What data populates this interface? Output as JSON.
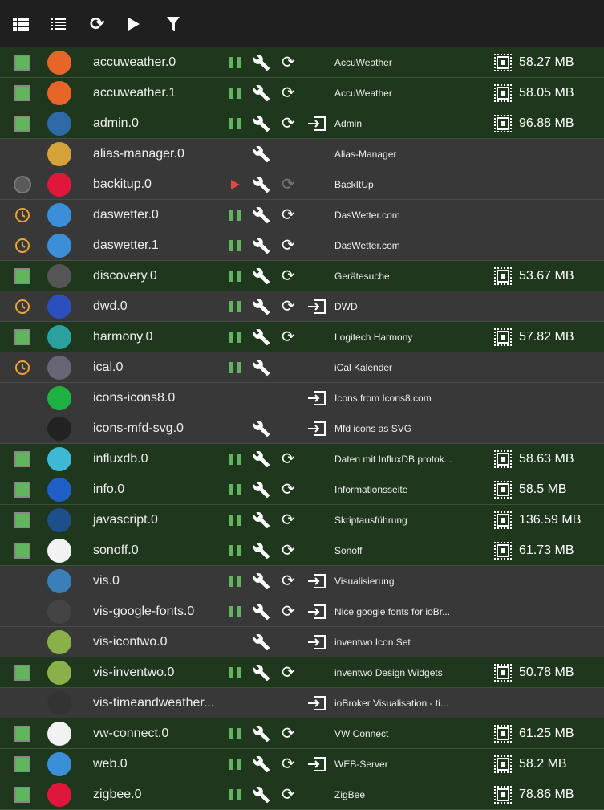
{
  "toolbar": {
    "icons": [
      "view-table-icon",
      "view-list-icon",
      "refresh-icon",
      "play-icon",
      "filter-icon"
    ]
  },
  "colors": {
    "running": "#1e371d",
    "stopped": "#383838",
    "status_green": "#5fb65c",
    "clock": "#e8a33c",
    "play": "#e04848"
  },
  "instances": [
    {
      "name": "accuweather.0",
      "status": "green",
      "pause": true,
      "wrench": true,
      "restart": true,
      "link": false,
      "title": "AccuWeather",
      "mem": "58.27 MB",
      "icon": "#e8652a"
    },
    {
      "name": "accuweather.1",
      "status": "green",
      "pause": true,
      "wrench": true,
      "restart": true,
      "link": false,
      "title": "AccuWeather",
      "mem": "58.05 MB",
      "icon": "#e8652a"
    },
    {
      "name": "admin.0",
      "status": "green",
      "pause": true,
      "wrench": true,
      "restart": true,
      "link": true,
      "title": "Admin",
      "mem": "96.88 MB",
      "icon": "#2f6aa8"
    },
    {
      "name": "alias-manager.0",
      "status": "none",
      "pause": false,
      "wrench": true,
      "restart": false,
      "link": false,
      "title": "Alias-Manager",
      "mem": "",
      "icon": "#d6a23a"
    },
    {
      "name": "backitup.0",
      "status": "gray",
      "play": true,
      "wrench": true,
      "restart": "disabled",
      "link": false,
      "title": "BackItUp",
      "mem": "",
      "icon": "#e0173c"
    },
    {
      "name": "daswetter.0",
      "status": "clock",
      "pause": true,
      "wrench": true,
      "restart": true,
      "link": false,
      "title": "DasWetter.com",
      "mem": "",
      "icon": "#3a8fd8"
    },
    {
      "name": "daswetter.1",
      "status": "clock",
      "pause": true,
      "wrench": true,
      "restart": true,
      "link": false,
      "title": "DasWetter.com",
      "mem": "",
      "icon": "#3a8fd8"
    },
    {
      "name": "discovery.0",
      "status": "green",
      "pause": true,
      "wrench": true,
      "restart": true,
      "link": false,
      "title": "Gerätesuche",
      "mem": "53.67 MB",
      "icon": "#555"
    },
    {
      "name": "dwd.0",
      "status": "clock",
      "pause": true,
      "wrench": true,
      "restart": true,
      "link": true,
      "title": "DWD",
      "mem": "",
      "icon": "#2c4fc0"
    },
    {
      "name": "harmony.0",
      "status": "green",
      "pause": true,
      "wrench": true,
      "restart": true,
      "link": false,
      "title": "Logitech Harmony",
      "mem": "57.82 MB",
      "icon": "#2aa0a0"
    },
    {
      "name": "ical.0",
      "status": "clock",
      "pause": true,
      "wrench": true,
      "restart": false,
      "link": false,
      "title": "iCal Kalender",
      "mem": "",
      "icon": "#667"
    },
    {
      "name": "icons-icons8.0",
      "status": "none",
      "pause": false,
      "wrench": false,
      "restart": false,
      "link": true,
      "title": "Icons from Icons8.com",
      "mem": "",
      "icon": "#1fb141"
    },
    {
      "name": "icons-mfd-svg.0",
      "status": "none",
      "pause": false,
      "wrench": true,
      "restart": false,
      "link": true,
      "title": "Mfd icons as SVG",
      "mem": "",
      "icon": "#222"
    },
    {
      "name": "influxdb.0",
      "status": "green",
      "pause": true,
      "wrench": true,
      "restart": true,
      "link": false,
      "title": "Daten mit InfluxDB protok...",
      "mem": "58.63 MB",
      "icon": "#3fb8d6"
    },
    {
      "name": "info.0",
      "status": "green",
      "pause": true,
      "wrench": true,
      "restart": true,
      "link": false,
      "title": "Informationsseite",
      "mem": "58.5 MB",
      "icon": "#1f5fc8"
    },
    {
      "name": "javascript.0",
      "status": "green",
      "pause": true,
      "wrench": true,
      "restart": true,
      "link": false,
      "title": "Skriptausführung",
      "mem": "136.59 MB",
      "icon": "#1d4f8a"
    },
    {
      "name": "sonoff.0",
      "status": "green",
      "pause": true,
      "wrench": true,
      "restart": true,
      "link": false,
      "title": "Sonoff",
      "mem": "61.73 MB",
      "icon": "#f2f2f2"
    },
    {
      "name": "vis.0",
      "status": "none",
      "pause": true,
      "wrench": true,
      "restart": true,
      "link": true,
      "title": "Visualisierung",
      "mem": "",
      "icon": "#3a7fb8"
    },
    {
      "name": "vis-google-fonts.0",
      "status": "none",
      "pause": true,
      "wrench": true,
      "restart": true,
      "link": true,
      "title": "Nice google fonts for ioBr...",
      "mem": "",
      "icon": "#444"
    },
    {
      "name": "vis-icontwo.0",
      "status": "none",
      "pause": false,
      "wrench": true,
      "restart": false,
      "link": true,
      "title": "inventwo Icon Set",
      "mem": "",
      "icon": "#8ab04a"
    },
    {
      "name": "vis-inventwo.0",
      "status": "green",
      "pause": true,
      "wrench": true,
      "restart": true,
      "link": false,
      "title": "inventwo Design Widgets",
      "mem": "50.78 MB",
      "icon": "#8ab04a"
    },
    {
      "name": "vis-timeandweather...",
      "status": "none",
      "pause": false,
      "wrench": false,
      "restart": false,
      "link": true,
      "title": "ioBroker Visualisation - ti...",
      "mem": "",
      "icon": "#333"
    },
    {
      "name": "vw-connect.0",
      "status": "green",
      "pause": true,
      "wrench": true,
      "restart": true,
      "link": false,
      "title": "VW Connect",
      "mem": "61.25 MB",
      "icon": "#f2f2f2"
    },
    {
      "name": "web.0",
      "status": "green",
      "pause": true,
      "wrench": true,
      "restart": true,
      "link": true,
      "title": "WEB-Server",
      "mem": "58.2 MB",
      "icon": "#3a8fd8"
    },
    {
      "name": "zigbee.0",
      "status": "green",
      "pause": true,
      "wrench": true,
      "restart": true,
      "link": false,
      "title": "ZigBee",
      "mem": "78.86 MB",
      "icon": "#e0173c"
    }
  ]
}
